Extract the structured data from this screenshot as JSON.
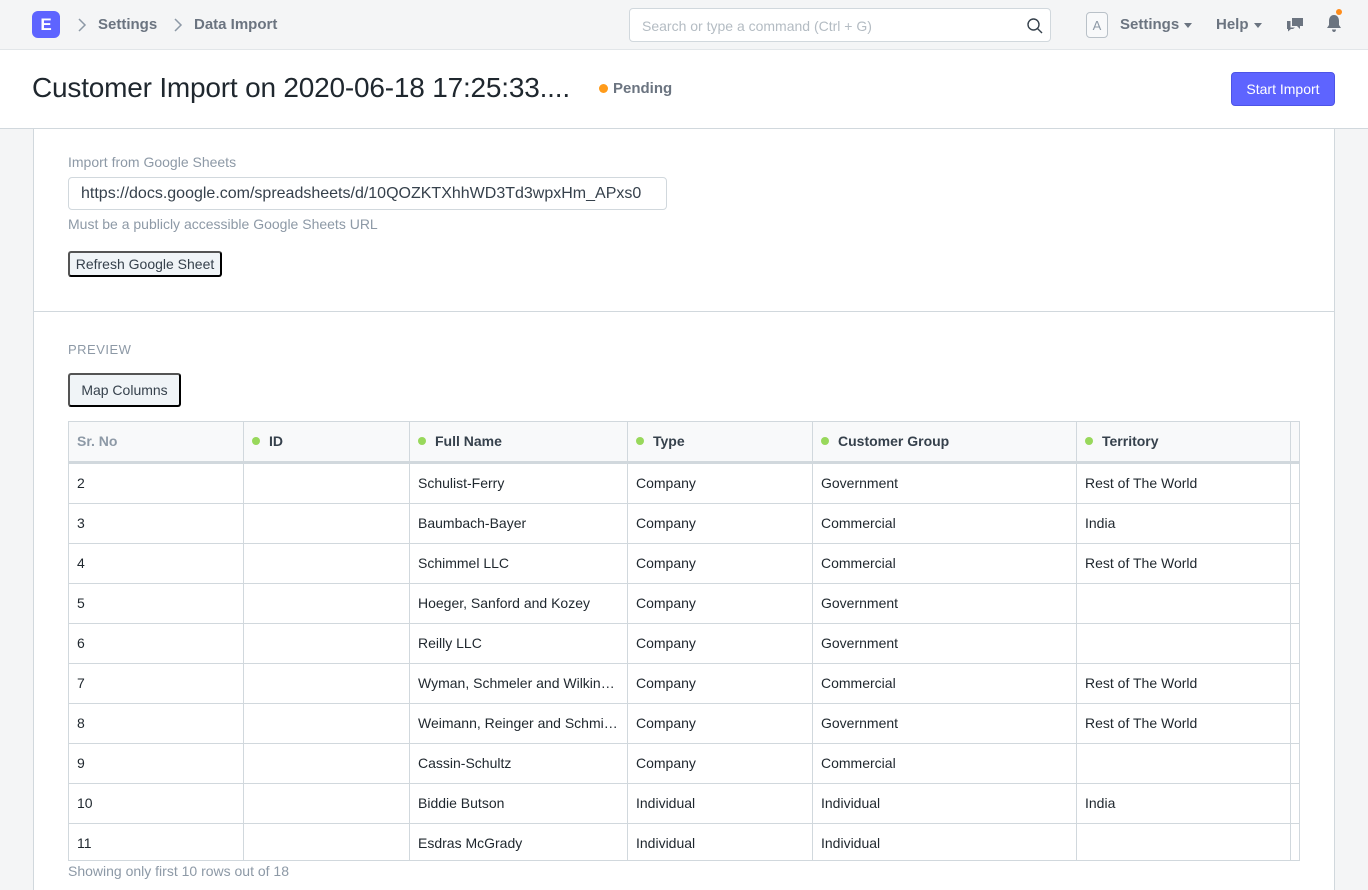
{
  "app": {
    "logo_letter": "E"
  },
  "breadcrumbs": [
    "Settings",
    "Data Import"
  ],
  "search": {
    "placeholder": "Search or type a command (Ctrl + G)"
  },
  "navbar": {
    "avatar_letter": "A",
    "settings_label": "Settings",
    "help_label": "Help"
  },
  "page": {
    "title": "Customer Import on 2020-06-18 17:25:33....",
    "status": "Pending",
    "status_color": "#ff9b1a",
    "primary_action": "Start Import"
  },
  "google_sheets": {
    "label": "Import from Google Sheets",
    "url": "https://docs.google.com/spreadsheets/d/10QOZKTXhhWD3Td3wpxHm_APxs0",
    "help": "Must be a publicly accessible Google Sheets URL",
    "refresh_label": "Refresh Google Sheet"
  },
  "preview": {
    "label": "PREVIEW",
    "map_columns_label": "Map Columns",
    "columns": [
      "Sr. No",
      "ID",
      "Full Name",
      "Type",
      "Customer Group",
      "Territory"
    ],
    "rows": [
      [
        "2",
        "",
        "Schulist-Ferry",
        "Company",
        "Government",
        "Rest of The World"
      ],
      [
        "3",
        "",
        "Baumbach-Bayer",
        "Company",
        "Commercial",
        "India"
      ],
      [
        "4",
        "",
        "Schimmel LLC",
        "Company",
        "Commercial",
        "Rest of The World"
      ],
      [
        "5",
        "",
        "Hoeger, Sanford and Kozey",
        "Company",
        "Government",
        ""
      ],
      [
        "6",
        "",
        "Reilly LLC",
        "Company",
        "Government",
        ""
      ],
      [
        "7",
        "",
        "Wyman, Schmeler and Wilkin…",
        "Company",
        "Commercial",
        "Rest of The World"
      ],
      [
        "8",
        "",
        "Weimann, Reinger and Schmi…",
        "Company",
        "Government",
        "Rest of The World"
      ],
      [
        "9",
        "",
        "Cassin-Schultz",
        "Company",
        "Commercial",
        ""
      ],
      [
        "10",
        "",
        "Biddie Butson",
        "Individual",
        "Individual",
        "India"
      ],
      [
        "11",
        "",
        "Esdras McGrady",
        "Individual",
        "Individual",
        ""
      ]
    ],
    "footer": "Showing only first 10 rows out of 18"
  }
}
